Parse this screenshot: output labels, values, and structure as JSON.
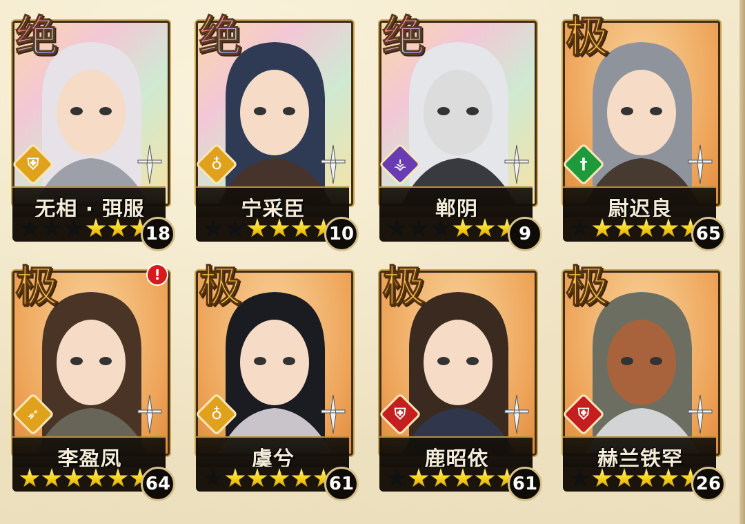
{
  "colors": {
    "background": "#efe4c4",
    "frame_gold": "#c9a24a",
    "star_lit": "#f5d21b",
    "class_yellow": "#e0a21d",
    "class_purple": "#6a3cb4",
    "class_green": "#1e9a3a",
    "class_red": "#c41e1e"
  },
  "cards": [
    {
      "grade": "绝",
      "name": "无相 · 弭服",
      "level": "18",
      "stars_lit": 3,
      "stars_total": 6,
      "class_icon": "shield-icon",
      "class_color": "#e0a21d",
      "portrait": "rainbow",
      "alert": false
    },
    {
      "grade": "绝",
      "name": "宁采臣",
      "level": "10",
      "stars_lit": 4,
      "stars_total": 6,
      "class_icon": "gourd-icon",
      "class_color": "#e0a21d",
      "portrait": "rainbow",
      "alert": false
    },
    {
      "grade": "绝",
      "name": "郸阴",
      "level": "9",
      "stars_lit": 3,
      "stars_total": 6,
      "class_icon": "talisman-icon",
      "class_color": "#6a3cb4",
      "portrait": "rainbow",
      "alert": false
    },
    {
      "grade": "极",
      "name": "尉迟良",
      "level": "65",
      "stars_lit": 5,
      "stars_total": 6,
      "class_icon": "sword-icon",
      "class_color": "#1e9a3a",
      "portrait": "orange",
      "alert": false
    },
    {
      "grade": "极",
      "name": "李盈凤",
      "level": "64",
      "stars_lit": 6,
      "stars_total": 6,
      "class_icon": "bow-icon",
      "class_color": "#e0a21d",
      "portrait": "orange",
      "alert": true,
      "alert_text": "!"
    },
    {
      "grade": "极",
      "name": "虞兮",
      "level": "61",
      "stars_lit": 5,
      "stars_total": 6,
      "class_icon": "gourd-icon",
      "class_color": "#e0a21d",
      "portrait": "orange",
      "alert": false
    },
    {
      "grade": "极",
      "name": "鹿昭依",
      "level": "61",
      "stars_lit": 5,
      "stars_total": 6,
      "class_icon": "shield-icon",
      "class_color": "#c41e1e",
      "portrait": "orange",
      "alert": false
    },
    {
      "grade": "极",
      "name": "赫兰铁罕",
      "level": "26",
      "stars_lit": 5,
      "stars_total": 6,
      "class_icon": "shield-icon",
      "class_color": "#c41e1e",
      "portrait": "orange",
      "alert": false
    }
  ]
}
